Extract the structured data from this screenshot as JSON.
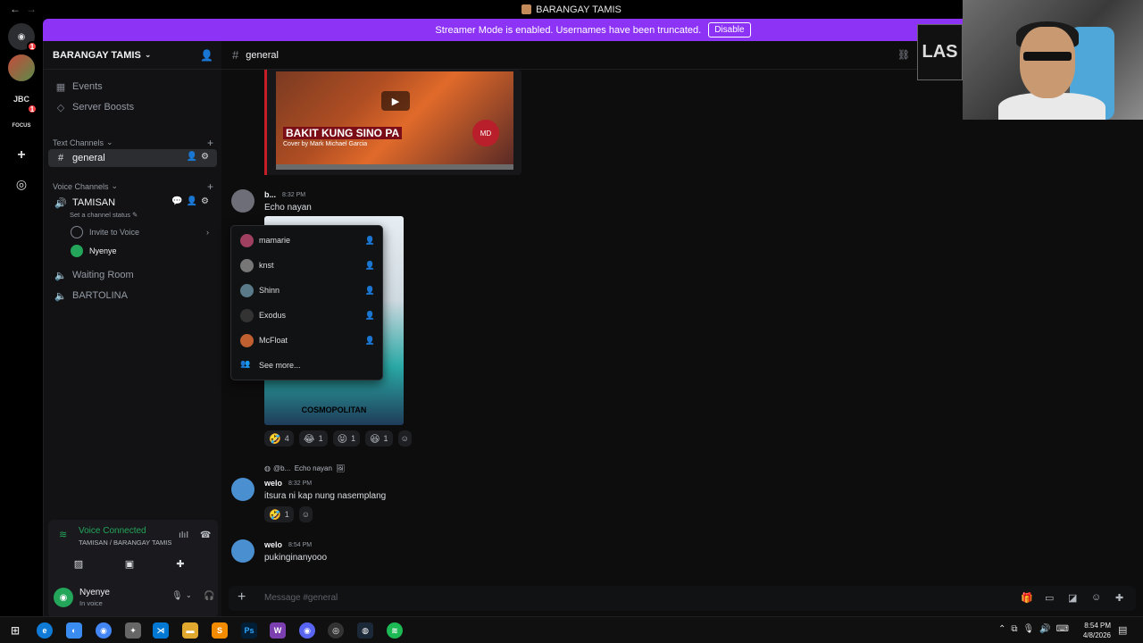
{
  "window": {
    "title": "BARANGAY TAMIS",
    "back": "←",
    "forward": "→"
  },
  "banner": {
    "text": "Streamer Mode is enabled. Usernames have been truncated.",
    "button": "Disable"
  },
  "rail": {
    "items": [
      {
        "label": "discord-home",
        "glyph": "◉",
        "badge": "1"
      },
      {
        "label": "server-avatar",
        "glyph": "",
        "badge": ""
      },
      {
        "label": "JBC",
        "glyph": "JBC",
        "badge": "1"
      },
      {
        "label": "FOCUS FORGE",
        "glyph": "FOCUS",
        "badge": ""
      },
      {
        "label": "add-server",
        "glyph": "+",
        "badge": ""
      },
      {
        "label": "explore",
        "glyph": "◎",
        "badge": ""
      }
    ]
  },
  "sidebar": {
    "server_name": "BARANGAY TAMIS",
    "events": "Events",
    "boosts": "Server Boosts",
    "text_category": "Text Channels",
    "general": "general",
    "voice_category": "Voice Channels",
    "voice_channel": "TAMISAN",
    "channel_status": "Set a channel status",
    "invite": "Invite to Voice",
    "voice_user": "Nyenye",
    "waiting_room": "Waiting Room",
    "bartolina": "BARTOLINA"
  },
  "voice_panel": {
    "status": "Voice Connected",
    "location": "TAMISAN / BARANGAY TAMIS"
  },
  "user": {
    "name": "Nyenye",
    "status": "In voice"
  },
  "channel": {
    "name": "general"
  },
  "embed": {
    "title": "BAKIT KUNG SINO PA",
    "subtitle": "Cover by Mark Michael Garcia",
    "logo": "MD"
  },
  "messages": [
    {
      "author": "b...",
      "time": "8:32 PM",
      "text": "Echo nayan",
      "image_caption": "COSMOPOLITAN",
      "reactions": [
        {
          "emoji": "🤣",
          "count": "4"
        },
        {
          "emoji": "😂",
          "count": "1"
        },
        {
          "emoji": "😝",
          "count": "1"
        },
        {
          "emoji": "😆",
          "count": "1"
        }
      ]
    },
    {
      "reply_author": "@b...",
      "reply_text": "Echo nayan",
      "author": "welo",
      "time": "8:32 PM",
      "text": "itsura ni kap nung nasemplang",
      "reactions": [
        {
          "emoji": "🤣",
          "count": "1"
        }
      ]
    },
    {
      "author": "welo",
      "time": "8:54 PM",
      "text": "pukinginanyooo"
    }
  ],
  "invite_popup": {
    "members": [
      {
        "name": "mamarie",
        "color": "#a04060"
      },
      {
        "name": "knst",
        "color": "#777777"
      },
      {
        "name": "Shinn",
        "color": "#5a7a8a"
      },
      {
        "name": "Exodus",
        "color": "#333333"
      },
      {
        "name": "McFloat",
        "color": "#c06030"
      }
    ],
    "see_more": "See more..."
  },
  "composer": {
    "placeholder": "Message #general"
  },
  "overlay_logo": "LAS",
  "taskbar": {
    "time": "8:54 PM",
    "date": "4/8/2026"
  },
  "colors": {
    "accent": "#8d33f6",
    "online": "#23a55a",
    "embed_border": "#c51e26"
  }
}
